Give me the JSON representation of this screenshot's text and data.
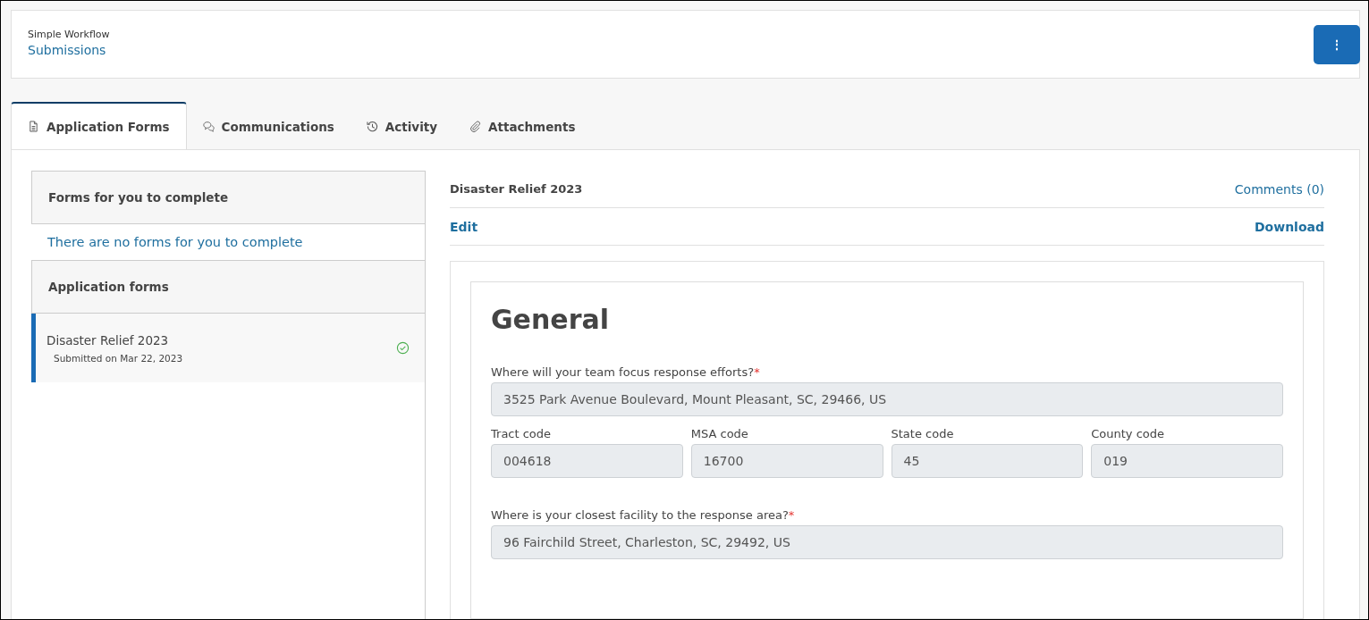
{
  "header": {
    "workflow": "Simple Workflow",
    "title": "Submissions",
    "menu_button": "⋮"
  },
  "tabs": [
    {
      "label": "Application Forms",
      "kind": "document",
      "selected": true
    },
    {
      "label": "Communications",
      "kind": "chat",
      "selected": false
    },
    {
      "label": "Activity",
      "kind": "history",
      "selected": false
    },
    {
      "label": "Attachments",
      "kind": "paperclip",
      "selected": false
    }
  ],
  "sidebar": {
    "sections": [
      {
        "title": "Forms for you to complete",
        "empty_message": "There are no forms for you to complete"
      },
      {
        "title": "Application forms",
        "items": [
          {
            "name": "Disaster Relief 2023",
            "date": "Submitted on Mar 22, 2023",
            "selected": true,
            "completed": true
          }
        ]
      }
    ]
  },
  "form_header": {
    "title": "Disaster Relief 2023",
    "comments_link": "Comments (0)",
    "edit_link": "Edit",
    "download_link": "Download"
  },
  "form": {
    "heading": "General",
    "items": [
      {
        "kind": "question",
        "label": "Where will your team focus response efforts?",
        "required_mark": "*",
        "value": "3525 Park Avenue Boulevard, Mount Pleasant, SC, 29466, US"
      },
      {
        "kind": "code_row",
        "fields": [
          {
            "label": "Tract code",
            "value": "004618"
          },
          {
            "label": "MSA code",
            "value": "16700"
          },
          {
            "label": "State code",
            "value": "45"
          },
          {
            "label": "County code",
            "value": "019"
          }
        ]
      },
      {
        "kind": "question",
        "label": "Where is your closest facility to the response area?",
        "required_mark": "*",
        "value": "96 Fairchild Street, Charleston, SC, 29492, US"
      }
    ]
  }
}
